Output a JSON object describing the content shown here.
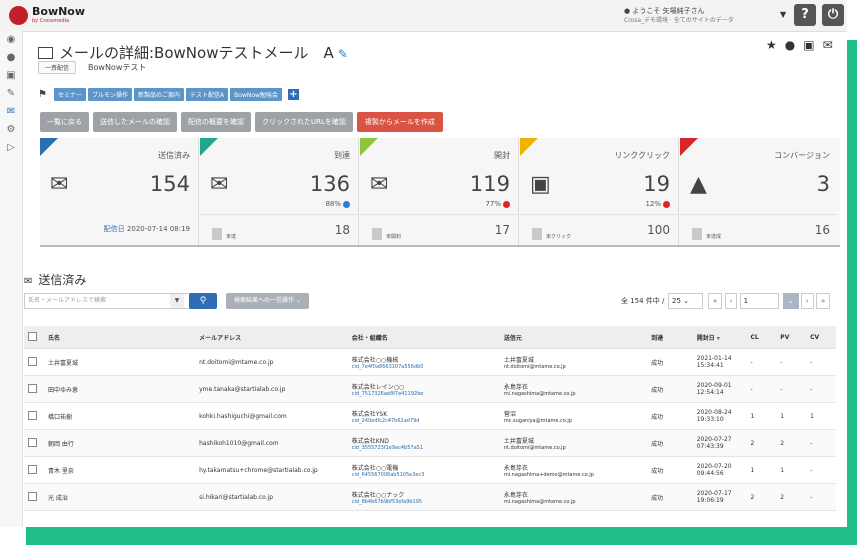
{
  "app": {
    "logo_text": "BowNow",
    "logo_sub": "by Crossmedia",
    "user_greeting": "ようこそ 矢場純子さん",
    "user_sub": "Crosa_デモ環境 · 全てのサイトのデータ",
    "help_label": "?",
    "power_label": "⏻"
  },
  "leftnav": [
    "dashboard-icon",
    "user-icon",
    "document-icon",
    "edit-icon",
    "mail-icon",
    "settings-icon",
    "play-icon"
  ],
  "header": {
    "title": "メールの詳細:BowNowテストメール　A",
    "delivery_badge": "一斉配信",
    "mail_name": "BowNowテスト"
  },
  "tags": [
    "セミナー",
    "ブルモン操作",
    "新製品のご案内",
    "テスト配信A",
    "BowNow勉強会"
  ],
  "actions": {
    "back": "一覧に戻る",
    "sent_mail": "送信したメールの確認",
    "summary": "配信の概要を確認",
    "clicked_urls": "クリックされたURLを確認",
    "create_from_copy": "複製からメールを作成"
  },
  "stats": [
    {
      "label": "送信済み",
      "value": "154",
      "pct": "",
      "sub_label": "",
      "sub_value": "",
      "date_label": "配信日",
      "date_value": "2020-07-14 08:19",
      "color": "#2a6fb0",
      "icon": "📨"
    },
    {
      "label": "到達",
      "value": "136",
      "pct": "88%",
      "sub_label": "未達",
      "sub_value": "18",
      "color": "#1fa88a",
      "icon": "✉"
    },
    {
      "label": "開封",
      "value": "119",
      "pct": "77%",
      "sub_label": "未開封",
      "sub_value": "17",
      "color": "#8cc63e",
      "icon": "✉"
    },
    {
      "label": "リンククリック",
      "value": "19",
      "pct": "12%",
      "sub_label": "未クリック",
      "sub_value": "100",
      "color": "#f0b400",
      "icon": "🖱"
    },
    {
      "label": "コンバージョン",
      "value": "3",
      "pct": "",
      "sub_label": "未達成",
      "sub_value": "16",
      "color": "#d9262b",
      "icon": "⛰"
    }
  ],
  "list": {
    "title": "送信済み",
    "search_placeholder": "氏名・メールアドレスで検索",
    "bulk_label": "検索結果への一括操作 ⌄",
    "count_text": "全 154 件中 /",
    "per_page": "25",
    "page": "1",
    "pager_prev2": "«",
    "pager_prev": "‹",
    "pager_next": "›",
    "pager_next2": "»",
    "pager_caret": "⌄"
  },
  "table": {
    "headers": [
      "氏名",
      "メールアドレス",
      "会社・組織名",
      "送信元",
      "到達",
      "開封日",
      "CL",
      "PV",
      "CV"
    ],
    "rows": [
      {
        "name": "土井富夏城",
        "email": "nt.doitomi@mtame.co.jp",
        "company": "株式会社○○機械",
        "cid": "cid_7e4f0a8663107a556db0",
        "from_name": "土井富夏城",
        "from_email": "nt.doitomi@mtame.co.jp",
        "status": "成功",
        "date": "2021-01-14",
        "time": "15:34:41",
        "cl": "-",
        "pv": "-",
        "cv": "-"
      },
      {
        "name": "田中ゆみ恵",
        "email": "yme.tanaka@startialab.co.jp",
        "company": "株式会社レイン○○",
        "cid": "cid_7517326ae8f7e41192be",
        "from_name": "永島芽衣",
        "from_email": "mi.nagashima@mtame.co.jp",
        "status": "成功",
        "date": "2020-09-01",
        "time": "12:54:14",
        "cl": "-",
        "pv": "-",
        "cv": "-"
      },
      {
        "name": "橋口祐樹",
        "email": "kohki.hashiguchi@gmail.com",
        "company": "株式会社YSK",
        "cid": "cid_240edfc2c47b62ad79d",
        "from_name": "菅沼",
        "from_email": "mc.suganiya@mtame.co.jp",
        "status": "成功",
        "date": "2020-08-24",
        "time": "19:33:10",
        "cl": "1",
        "pv": "1",
        "cv": "1"
      },
      {
        "name": "朝岡 由行",
        "email": "hashikoh1010@gmail.com",
        "company": "株式会社KND",
        "cid": "cid_3555723f1e9ac4b57a51",
        "from_name": "土井富夏城",
        "from_email": "nt.doitomi@mtame.co.jp",
        "status": "成功",
        "date": "2020-07-27",
        "time": "07:43:39",
        "cl": "2",
        "pv": "2",
        "cv": "-"
      },
      {
        "name": "青木 里奈",
        "email": "hy.takamatsu+chrome@startialab.co.jp",
        "company": "株式会社○○電機",
        "cid": "cid_645567006ab5105e3ec3",
        "from_name": "永島芽衣",
        "from_email": "mi.nagashima+demo@mtame.co.jp",
        "status": "成功",
        "date": "2020-07-20",
        "time": "09:44:56",
        "cl": "1",
        "pv": "1",
        "cv": "-"
      },
      {
        "name": "光 成治",
        "email": "si.hikari@startialab.co.jp",
        "company": "株式会社○○ナック",
        "cid": "cid_8b4b67b9bf53efa9b195",
        "from_name": "永島芽衣",
        "from_email": "mi.nagashima@mtame.co.jp",
        "status": "成功",
        "date": "2020-07-17",
        "time": "19:06:19",
        "cl": "2",
        "pv": "2",
        "cv": "-"
      }
    ]
  }
}
